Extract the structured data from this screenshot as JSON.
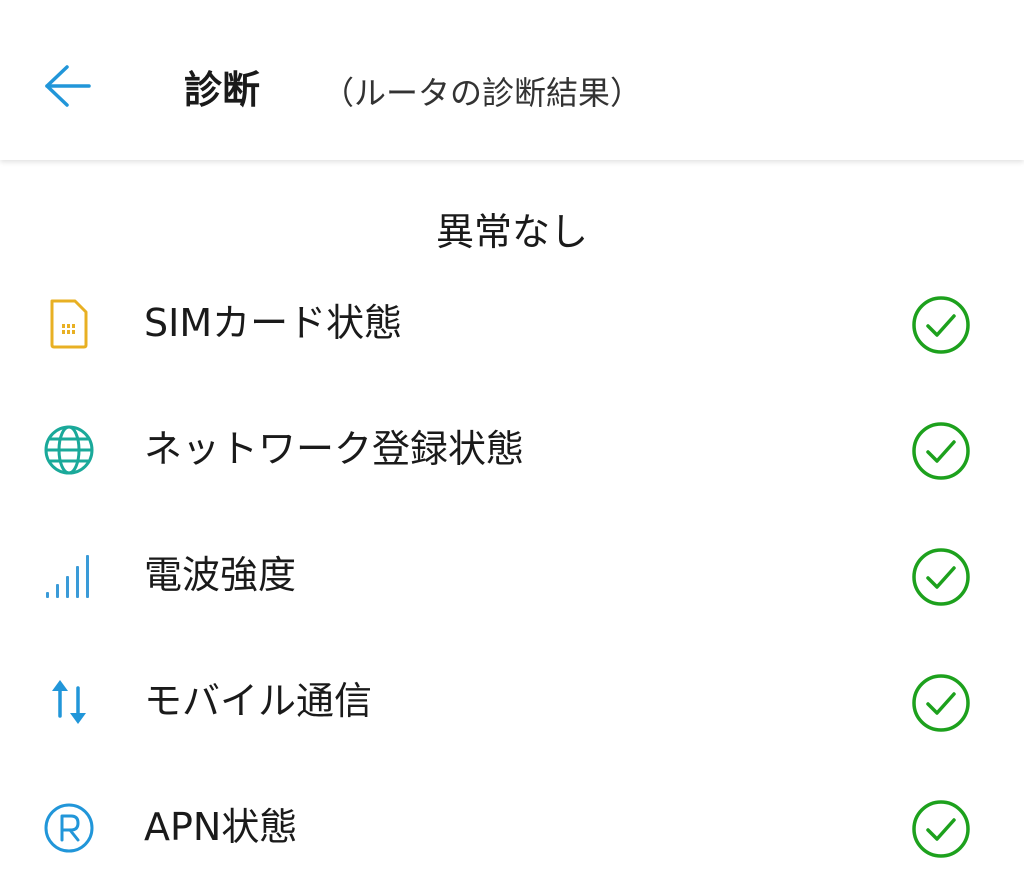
{
  "header": {
    "title": "診断",
    "subtitle": "（ルータの診断結果）",
    "back_icon": "arrow-left-icon"
  },
  "summary": {
    "text": "異常なし"
  },
  "items": [
    {
      "label": "SIMカード状態",
      "icon": "sim-card-icon",
      "icon_color": "#E8B023",
      "status": "ok"
    },
    {
      "label": "ネットワーク登録状態",
      "icon": "globe-icon",
      "icon_color": "#1AA99A",
      "status": "ok"
    },
    {
      "label": "電波強度",
      "icon": "signal-bars-icon",
      "icon_color": "#3A9BD8",
      "status": "ok"
    },
    {
      "label": "モバイル通信",
      "icon": "data-transfer-icon",
      "icon_color": "#2196D9",
      "status": "ok"
    },
    {
      "label": "APN状態",
      "icon": "registered-icon",
      "icon_color": "#2196D9",
      "status": "ok"
    }
  ],
  "colors": {
    "accent": "#2196D9",
    "ok": "#1DA11D"
  }
}
